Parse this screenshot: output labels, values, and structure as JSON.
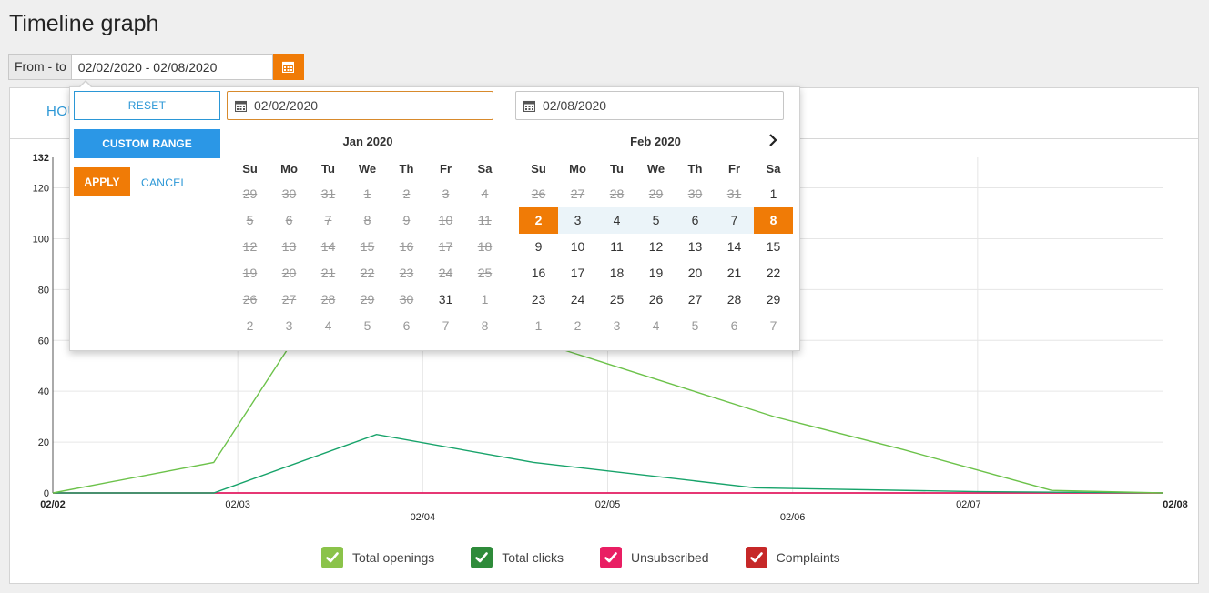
{
  "page": {
    "title": "Timeline graph"
  },
  "range": {
    "label": "From - to",
    "value": "02/02/2020 - 02/08/2020"
  },
  "tabs": {
    "hours": "HOURS"
  },
  "picker": {
    "reset": "RESET",
    "custom_range": "CUSTOM RANGE",
    "apply": "APPLY",
    "cancel": "CANCEL",
    "start_input": "02/02/2020",
    "end_input": "02/08/2020",
    "weekdays": [
      "Su",
      "Mo",
      "Tu",
      "We",
      "Th",
      "Fr",
      "Sa"
    ],
    "left_month": {
      "title": "Jan 2020",
      "days": [
        [
          "29",
          "30",
          "31",
          "1",
          "2",
          "3",
          "4"
        ],
        [
          "5",
          "6",
          "7",
          "8",
          "9",
          "10",
          "11"
        ],
        [
          "12",
          "13",
          "14",
          "15",
          "16",
          "17",
          "18"
        ],
        [
          "19",
          "20",
          "21",
          "22",
          "23",
          "24",
          "25"
        ],
        [
          "26",
          "27",
          "28",
          "29",
          "30",
          "31",
          "1"
        ],
        [
          "2",
          "3",
          "4",
          "5",
          "6",
          "7",
          "8"
        ]
      ],
      "disabled_count": 33
    },
    "right_month": {
      "title": "Feb 2020",
      "days": [
        [
          "26",
          "27",
          "28",
          "29",
          "30",
          "31",
          "1"
        ],
        [
          "2",
          "3",
          "4",
          "5",
          "6",
          "7",
          "8"
        ],
        [
          "9",
          "10",
          "11",
          "12",
          "13",
          "14",
          "15"
        ],
        [
          "16",
          "17",
          "18",
          "19",
          "20",
          "21",
          "22"
        ],
        [
          "23",
          "24",
          "25",
          "26",
          "27",
          "28",
          "29"
        ],
        [
          "1",
          "2",
          "3",
          "4",
          "5",
          "6",
          "7"
        ]
      ],
      "selected_start": "2",
      "selected_end": "8"
    }
  },
  "chart_data": {
    "type": "line",
    "x_ticks": [
      "02/02",
      "02/03",
      "02/04",
      "02/05",
      "02/06",
      "02/07",
      "02/08"
    ],
    "y_ticks": [
      0,
      20,
      40,
      60,
      80,
      100,
      120,
      132
    ],
    "ylim": [
      0,
      132
    ],
    "xlim": [
      0,
      6
    ],
    "grid": true,
    "series": [
      {
        "name": "Total openings",
        "color": "#6cc24a",
        "x": [
          0,
          0.87,
          1.3,
          2.0,
          2.35,
          2.6,
          3.9,
          4.6,
          5.4,
          6.0
        ],
        "y": [
          0,
          12,
          60,
          90,
          90,
          60,
          30,
          17,
          1,
          0
        ]
      },
      {
        "name": "Total clicks",
        "color": "#17a36a",
        "x": [
          0,
          0.87,
          1.75,
          2.6,
          3.8,
          5.0,
          6.0
        ],
        "y": [
          0,
          0,
          23,
          12,
          2,
          0.5,
          0
        ]
      },
      {
        "name": "Unsubscribed",
        "color": "#e8196a",
        "x": [
          0,
          6
        ],
        "y": [
          0,
          0
        ]
      },
      {
        "name": "Complaints",
        "color": "#c62828",
        "x": [
          0,
          6
        ],
        "y": [
          0,
          0
        ]
      }
    ]
  },
  "legend": [
    {
      "label": "Total openings",
      "color": "#8bc34a"
    },
    {
      "label": "Total clicks",
      "color": "#2e8b3a"
    },
    {
      "label": "Unsubscribed",
      "color": "#e91e63"
    },
    {
      "label": "Complaints",
      "color": "#c62828"
    }
  ]
}
